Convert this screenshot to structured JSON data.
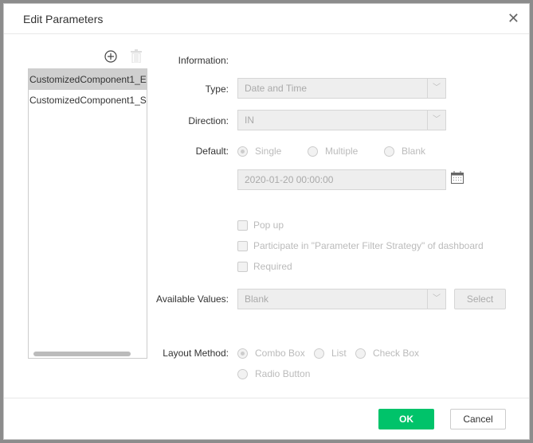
{
  "dialog": {
    "title": "Edit Parameters",
    "close_icon": "close-icon"
  },
  "params": {
    "items": [
      "CustomizedComponent1_E",
      "CustomizedComponent1_S"
    ],
    "selected": 0
  },
  "form": {
    "information_label": "Information:",
    "type_label": "Type:",
    "type_value": "Date and Time",
    "direction_label": "Direction:",
    "direction_value": "IN",
    "default_label": "Default:",
    "default_options": [
      "Single",
      "Multiple",
      "Blank"
    ],
    "default_selected": "Single",
    "default_value": "2020-01-20 00:00:00",
    "checkboxes": [
      "Pop up",
      "Participate in \"Parameter Filter Strategy\" of dashboard",
      "Required"
    ],
    "available_label": "Available Values:",
    "available_value": "Blank",
    "select_label": "Select",
    "layout_label": "Layout Method:",
    "layout_options": [
      "Combo Box",
      "List",
      "Check Box",
      "Radio Button"
    ],
    "layout_selected": "Combo Box"
  },
  "footer": {
    "ok": "OK",
    "cancel": "Cancel"
  },
  "colors": {
    "accent": "#00c36a"
  }
}
